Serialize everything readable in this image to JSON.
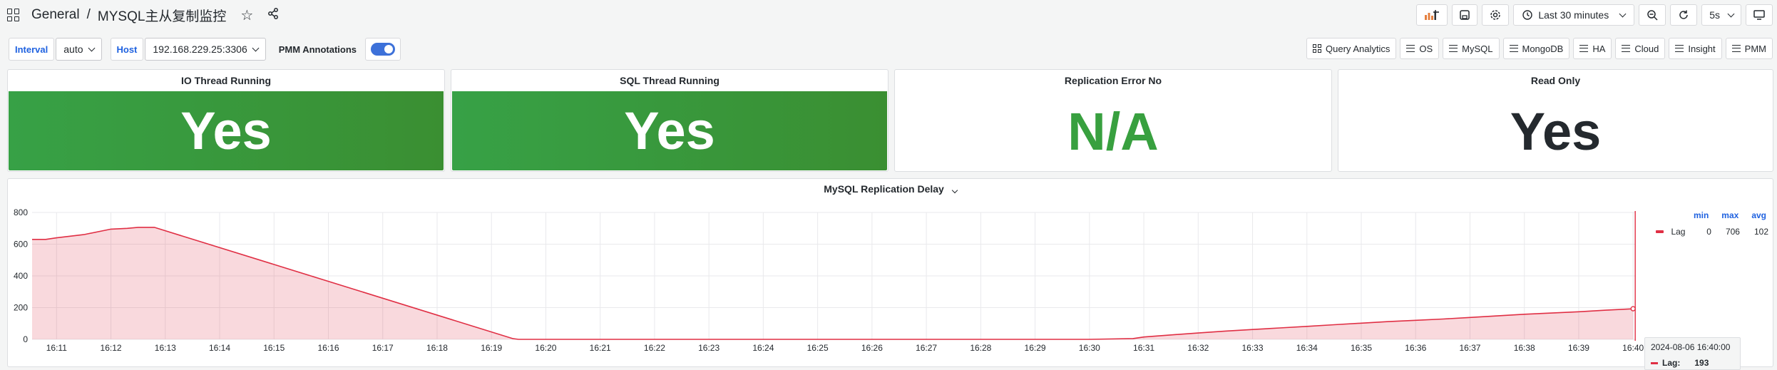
{
  "nav": {
    "section": "General",
    "separator": "/",
    "title": "MYSQL主从复制监控",
    "time_range": "Last 30 minutes",
    "refresh": "5s"
  },
  "vars": {
    "interval_label": "Interval",
    "interval_value": "auto",
    "host_label": "Host",
    "host_value": "192.168.229.25:3306",
    "annotations_label": "PMM Annotations",
    "annotations_on": true
  },
  "links": [
    "Query Analytics",
    "OS",
    "MySQL",
    "MongoDB",
    "HA",
    "Cloud",
    "Insight",
    "PMM"
  ],
  "stats": [
    {
      "title": "IO Thread Running",
      "value": "Yes"
    },
    {
      "title": "SQL Thread Running",
      "value": "Yes"
    },
    {
      "title": "Replication Error No",
      "value": "N/A"
    },
    {
      "title": "Read Only",
      "value": "Yes"
    }
  ],
  "colors": {
    "green_bg": "#37a146",
    "green_text": "#38a03f",
    "series": "#e02f44",
    "accent": "#1f62e0"
  },
  "graph": {
    "title": "MySQL Replication Delay",
    "legend": {
      "headers": [
        "min",
        "max",
        "avg"
      ],
      "series_name": "Lag",
      "min": "0",
      "max": "706",
      "avg": "102"
    },
    "tooltip": {
      "time": "2024-08-06 16:40:00",
      "label": "Lag:",
      "value": "193"
    }
  },
  "chart_data": {
    "type": "area",
    "title": "MySQL Replication Delay",
    "xlabel": "",
    "ylabel": "",
    "yticks": [
      0,
      200,
      400,
      600,
      800
    ],
    "ylim": [
      0,
      800
    ],
    "xticks": [
      "16:11",
      "16:12",
      "16:13",
      "16:14",
      "16:15",
      "16:16",
      "16:17",
      "16:18",
      "16:19",
      "16:20",
      "16:21",
      "16:22",
      "16:23",
      "16:24",
      "16:25",
      "16:26",
      "16:27",
      "16:28",
      "16:29",
      "16:30",
      "16:31",
      "16:32",
      "16:33",
      "16:34",
      "16:35",
      "16:36",
      "16:37",
      "16:38",
      "16:39",
      "16:40"
    ],
    "xlim": [
      10.55,
      40.05
    ],
    "series": [
      {
        "name": "Lag",
        "x": [
          10.55,
          10.8,
          11.0,
          11.5,
          12.0,
          12.3,
          12.5,
          12.8,
          19.4,
          19.5,
          20,
          21,
          22,
          23,
          24,
          25,
          26,
          27,
          28,
          29,
          30,
          30.8,
          31.0,
          31.5,
          32.0,
          32.5,
          33.0,
          33.5,
          34.0,
          34.5,
          35.0,
          35.5,
          36.0,
          36.5,
          37.0,
          37.5,
          38.0,
          38.5,
          39.0,
          39.5,
          40.0
        ],
        "values": [
          630,
          630,
          640,
          660,
          695,
          700,
          706,
          706,
          4,
          0,
          0,
          0,
          0,
          0,
          0,
          0,
          0,
          0,
          0,
          0,
          0,
          5,
          15,
          28,
          40,
          52,
          62,
          72,
          82,
          92,
          102,
          112,
          120,
          128,
          138,
          148,
          158,
          166,
          174,
          184,
          193
        ]
      }
    ]
  }
}
